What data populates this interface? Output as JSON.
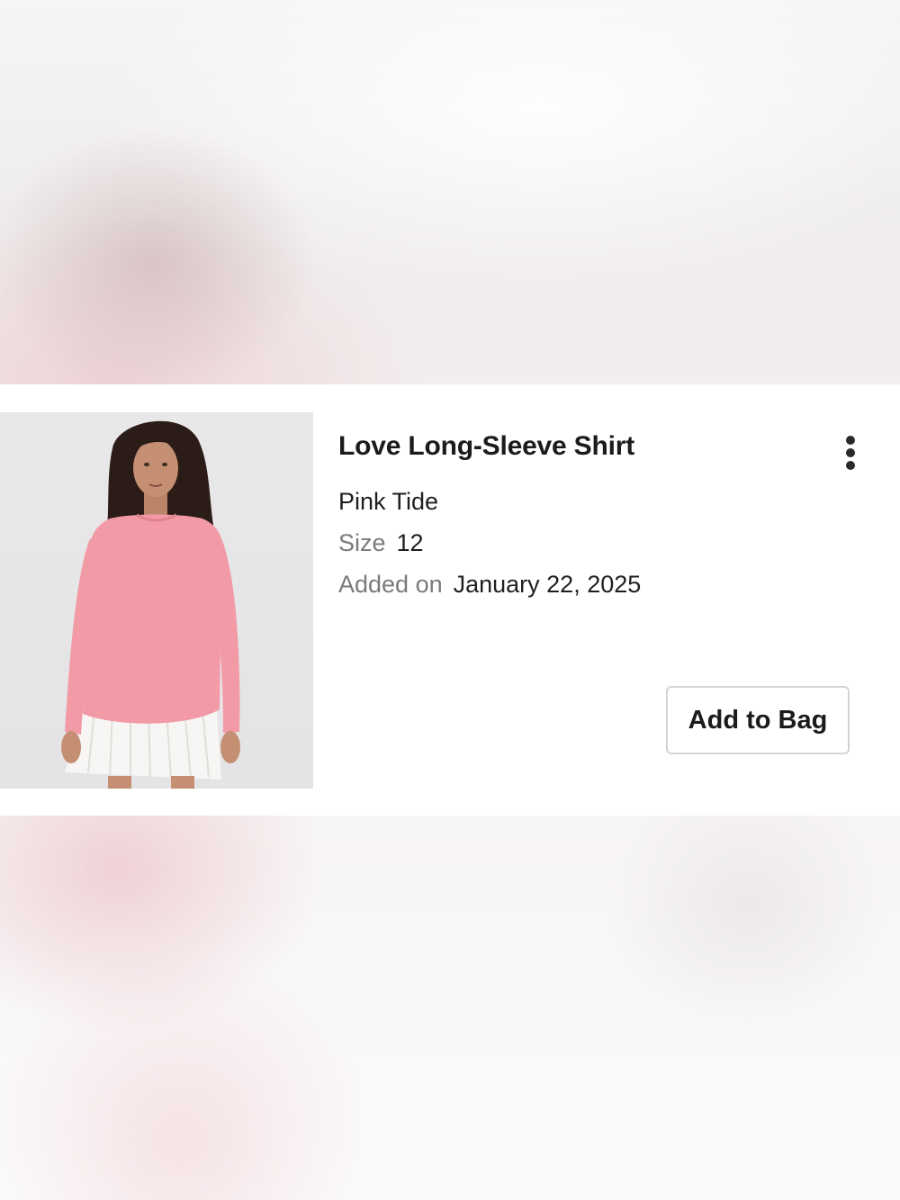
{
  "product": {
    "title": "Love Long-Sleeve Shirt",
    "color": "Pink Tide",
    "size_label": "Size",
    "size_value": "12",
    "added_label": "Added on",
    "added_value": "January 22, 2025",
    "image_alt": "model-wearing-pink-long-sleeve-shirt"
  },
  "actions": {
    "add_to_bag": "Add to Bag",
    "more_icon": "more-vertical-icon"
  },
  "colors": {
    "shirt": "#f29aa6",
    "text": "#1b1b1b",
    "muted": "#7a7a7a",
    "border": "#d4d4d4"
  }
}
